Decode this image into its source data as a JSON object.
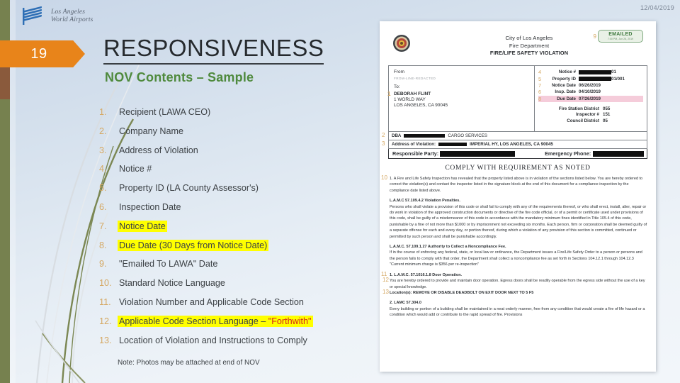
{
  "slide": {
    "date": "12/04/2019",
    "number": "19",
    "title": "RESPONSIVENESS",
    "subtitle": "NOV Contents – Sample"
  },
  "logo": {
    "line1": "Los Angeles",
    "line2": "World Airports",
    "mark": "lawa-flag-icon"
  },
  "nov_list": {
    "items": [
      {
        "num": "1.",
        "label": "Recipient (LAWA CEO)",
        "highlight": false
      },
      {
        "num": "2.",
        "label": "Company Name",
        "highlight": false
      },
      {
        "num": "3.",
        "label": "Address of Violation",
        "highlight": false
      },
      {
        "num": "4.",
        "label": "Notice #",
        "highlight": false
      },
      {
        "num": "5.",
        "label": "Property ID (LA County Assessor's)",
        "highlight": false
      },
      {
        "num": "6.",
        "label": "Inspection Date",
        "highlight": false
      },
      {
        "num": "7.",
        "label": "Notice Date",
        "highlight": true
      },
      {
        "num": "8.",
        "label": "Due Date (30 Days from Notice Date)",
        "highlight": true
      },
      {
        "num": "9.",
        "label": "\"Emailed To LAWA\" Date",
        "highlight": false
      },
      {
        "num": "10.",
        "label": "Standard Notice Language",
        "highlight": false
      },
      {
        "num": "11.",
        "label": "Violation Number and Applicable Code Section",
        "highlight": false
      },
      {
        "num": "12.",
        "label": "Applicable Code Section Language – ",
        "label_accent": "\"Forthwith\"",
        "highlight": true
      },
      {
        "num": "13.",
        "label": "Location of Violation and Instructions to Comply",
        "highlight": false
      }
    ],
    "note": "Note: Photos may be attached at end of NOV"
  },
  "document": {
    "header": {
      "line1": "City of Los Angeles",
      "line2": "Fire Department",
      "line3": "FIRE/LIFE SAFETY VIOLATION",
      "seal": "la-fire-department-seal-icon"
    },
    "stamp": {
      "callout": "9",
      "label": "EMAILED",
      "sub": "7:00 PM, Jun 26, 2019"
    },
    "from": {
      "from_label": "From",
      "from_value": "FROM-LINE-REDACTED",
      "to_label": "To:",
      "callout": "1",
      "recipient_name": "DEBORAH FLINT",
      "recipient_street": "1 WORLD WAY",
      "recipient_city": "LOS ANGELES, CA 90045"
    },
    "notice_fields": [
      {
        "callout": "4",
        "label": "Notice #",
        "value": "01",
        "redacted": true,
        "due": false
      },
      {
        "callout": "5",
        "label": "Property ID",
        "value": "01/001",
        "redacted": true,
        "due": false
      },
      {
        "callout": "7",
        "label": "Notice Date",
        "value": "06/26/2019",
        "redacted": false,
        "due": false
      },
      {
        "callout": "6",
        "label": "Insp. Date",
        "value": "04/10/2019",
        "redacted": false,
        "due": false
      },
      {
        "callout": "8",
        "label": "Due Date",
        "value": "07/26/2019",
        "redacted": false,
        "due": true
      }
    ],
    "station_fields": [
      {
        "label": "Fire Station District",
        "value": "055"
      },
      {
        "label": "Inspector #",
        "value": "151"
      },
      {
        "label": "Council District",
        "value": "05"
      }
    ],
    "dba_row": {
      "callout": "2",
      "label": "DBA",
      "value": "CARGO SERVICES"
    },
    "address_row": {
      "callout": "3",
      "label": "Address of Violation:",
      "value": "IMPERIAL HY, LOS ANGELES, CA 90045"
    },
    "responsible_row": {
      "label": "Responsible Party:",
      "phone_label": "Emergency Phone:"
    },
    "comply_heading": "COMPLY WITH REQUIREMENT AS NOTED",
    "body": {
      "para10_callout": "10",
      "para10": "1. A Fire and Life Safety Inspection has revealed that the property listed above is in violation of the sections listed below. You are hereby ordered to correct the violation(s) and contact the inspector listed in the signature block at the end of this document for a compliance inspection by the compliance date listed above.",
      "penalty_head": "L.A.M.C 57.109.4.2 Violation Penalties.",
      "penalty_text": "Persons who shall violate a provision of this code or shall fail to comply with any of the requirements thereof, or who shall erect, install, alter, repair or do work in violation of the approved construction documents or directive of the fire code official, or of a permit or certificate used under provisions of this code, shall be guilty of a misdemeanor of this code in accordance with the mandatory minimum fines identified in Title 105.4 of this code, punishable by a fine of not more than $1000 or by imprisonment not exceeding six months. Each person, firm or corporation shall be deemed guilty of a separate offense for each and every day, or portion thereof, during which a violation of any provision of this section is committed, continued or permitted by such person and shall be punishable accordingly.",
      "fee_head": "L.A.M.C. 57.109.1.27 Authority to Collect a Noncompliance Fee.",
      "fee_text": "If in the course of enforcing any federal, state, or local law or ordinance, the Department issues a Fire/Life Safety Order to a person or persons and the person fails to comply with that order, the Department shall collect a noncompliance fee as set forth in Sections 104.12.1 through 104.12.3",
      "fee_note": "\"Current minimum charge is $356 per re-inspection\"",
      "v1_callout": "11",
      "v1_head": "1. L.A.M.C. 57.1016.1.8 Door Operation.",
      "v1_callout2": "12",
      "v1_text": "You are hereby ordered to provide and maintain door operation. Egress doors shall be readily operable from the egress side without the use of a key or special knowledge.",
      "v1_loc_callout": "13",
      "v1_loc": "Location(s): REMOVE OR DISABLE DEADBOLT ON EXIT DOOR NEXT TO 5 F5",
      "v2_head": "2. LAMC 57.304.0",
      "v2_text": "Every building or portion of a building shall be maintained in a neat orderly manner, free from any condition that would create a fire of life hazard or a condition which would add or contribute to the rapid spread of fire. Provisions"
    }
  }
}
